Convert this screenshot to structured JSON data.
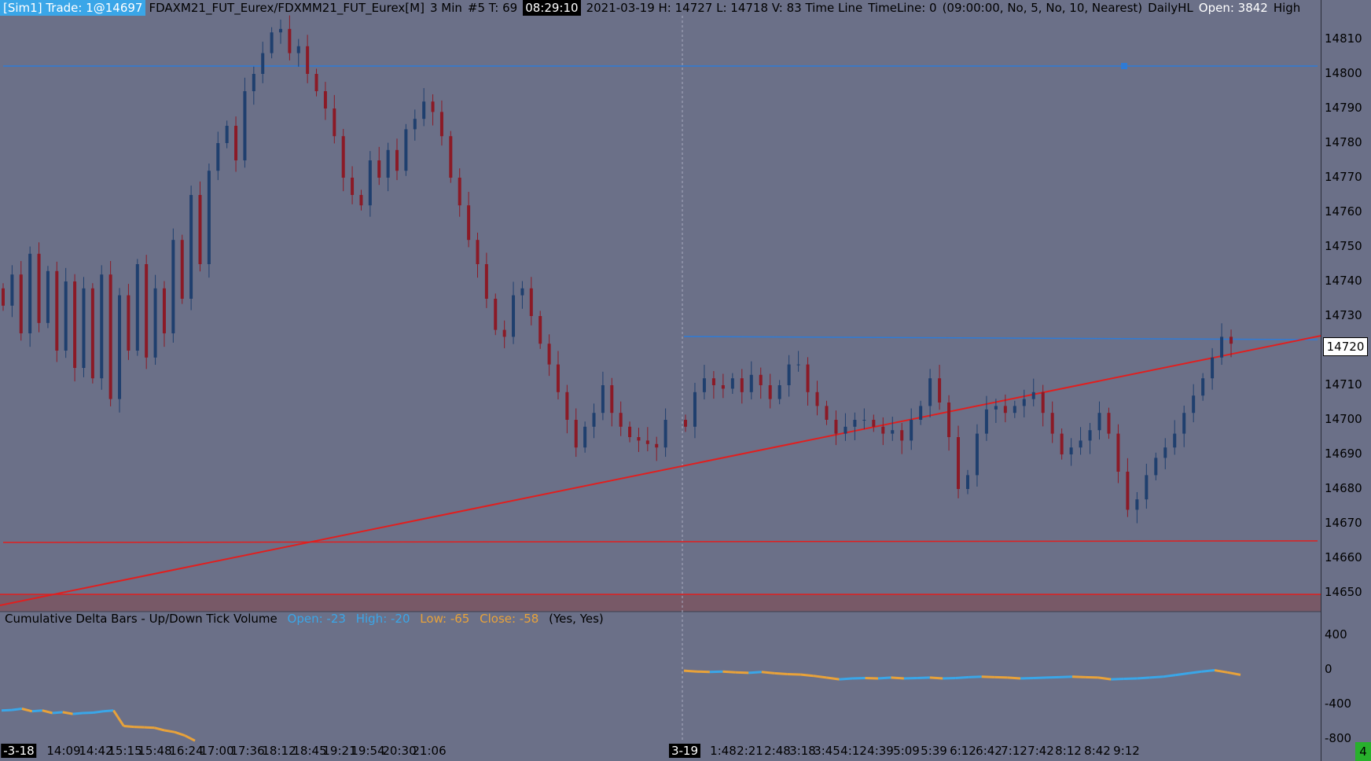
{
  "header": {
    "account": "[Sim1]  Trade: 1@14697",
    "instrument": "FDAXM21_FUT_Eurex/FDXMM21_FUT_Eurex[M]",
    "period": "3 Min",
    "bar_info": "#5 T: 69",
    "clock": "08:29:10",
    "bar_stats": "2021-03-19 H: 14727  L: 14718  V: 83 Time Line",
    "timeline": "TimeLine: 0",
    "params": "(09:00:00, No, 5, No, 10, Nearest)",
    "study": "DailyHL",
    "open": "Open: 3842",
    "high": "High"
  },
  "indicator": {
    "name": "Cumulative Delta Bars - Up/Down Tick Volume",
    "open": "Open: -23",
    "high": "High: -20",
    "low": "Low: -65",
    "close": "Close: -58",
    "flags": "(Yes, Yes)"
  },
  "price_axis": {
    "ticks": [
      "14810",
      "14800",
      "14790",
      "14780",
      "14770",
      "14760",
      "14750",
      "14740",
      "14730",
      "14710",
      "14700",
      "14690",
      "14680",
      "14670",
      "14660",
      "14650"
    ],
    "last_price": "14720"
  },
  "delta_axis": {
    "ticks": [
      "400",
      "0",
      "-400",
      "-800"
    ]
  },
  "time_axis": {
    "start_label": "-3-18",
    "session_label": "3-19",
    "labels": [
      "14:09",
      "14:42",
      "15:15",
      "15:48",
      "16:24",
      "17:00",
      "17:36",
      "18:12",
      "18:45",
      "19:21",
      "19:54",
      "20:30",
      "21:06",
      "1:48",
      "2:21",
      "2:48",
      "3:18",
      "3:45",
      "4:12",
      "4:39",
      "5:09",
      "5:39",
      "6:12",
      "6:42",
      "7:12",
      "7:42",
      "8:12",
      "8:42",
      "9:12"
    ]
  },
  "status": {
    "corner": "4"
  },
  "colors": {
    "background": "#6b7088",
    "up_candle": "#1f3f6e",
    "down_candle": "#8b1a26",
    "trendline": "#e01f1f",
    "blue_line": "#2f7bd6",
    "delta_up": "#3aa6e8",
    "delta_down": "#e8a23a"
  },
  "chart_data": {
    "type": "candlestick",
    "ylim": [
      14643,
      14815
    ],
    "price_path": [
      14738,
      14733,
      14742,
      14725,
      14748,
      14728,
      14743,
      14720,
      14740,
      14715,
      14738,
      14712,
      14742,
      14706,
      14736,
      14720,
      14745,
      14718,
      14738,
      14725,
      14752,
      14735,
      14765,
      14745,
      14772,
      14780,
      14785,
      14775,
      14795,
      14800,
      14806,
      14812,
      14813,
      14806,
      14808,
      14800,
      14795,
      14790,
      14782,
      14770,
      14765,
      14762,
      14775,
      14770,
      14778,
      14772,
      14784,
      14787,
      14792,
      14789,
      14782,
      14770,
      14762,
      14752,
      14745,
      14735,
      14726,
      14724,
      14736,
      14738,
      14730,
      14722,
      14716,
      14708,
      14700,
      14692,
      14698,
      14702,
      14710,
      14702,
      14698,
      14695,
      14694,
      14693,
      14692,
      14700,
      14698,
      14708,
      14712,
      14710,
      14709,
      14712,
      14708,
      14713,
      14710,
      14706,
      14710,
      14716,
      14716,
      14708,
      14704,
      14700,
      14696,
      14698,
      14700,
      14700,
      14698,
      14696,
      14697,
      14694,
      14700,
      14704,
      14712,
      14705,
      14695,
      14680,
      14684,
      14696,
      14703,
      14704,
      14702,
      14704,
      14706,
      14708,
      14702,
      14696,
      14690,
      14692,
      14694,
      14697,
      14702,
      14696,
      14685,
      14674,
      14677,
      14684,
      14689,
      14692,
      14696,
      14702,
      14707,
      14712,
      14718,
      14724,
      14722
    ]
  },
  "delta_data": {
    "type": "line",
    "series": [
      {
        "name": "session-1",
        "values": [
          -470,
          -465,
          -450,
          -480,
          -470,
          -500,
          -490,
          -510,
          -500,
          -495,
          -480,
          -470,
          -650,
          -660,
          -665,
          -670,
          -700,
          -720,
          -760,
          -820
        ]
      },
      {
        "name": "session-2",
        "values": [
          -10,
          -20,
          -25,
          -20,
          -30,
          -35,
          -25,
          -40,
          -50,
          -55,
          -70,
          -90,
          -110,
          -100,
          -95,
          -100,
          -90,
          -100,
          -95,
          -90,
          -100,
          -95,
          -85,
          -80,
          -85,
          -90,
          -100,
          -95,
          -90,
          -85,
          -80,
          -85,
          -90,
          -110,
          -105,
          -100,
          -90,
          -80,
          -60,
          -40,
          -20,
          -5,
          -30,
          -58
        ]
      }
    ]
  }
}
